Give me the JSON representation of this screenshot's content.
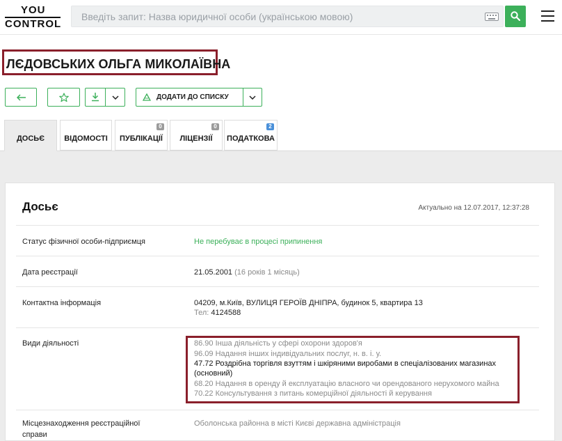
{
  "header": {
    "logo_top": "YOU",
    "logo_bottom": "CONTROL",
    "search_placeholder": "Введіть запит: Назва юридичної особи (українською мовою)"
  },
  "person": {
    "name": "ЛЄДОВСЬКИХ ОЛЬГА МИКОЛАЇВНА"
  },
  "actions": {
    "add_to_list": "ДОДАТИ ДО СПИСКУ"
  },
  "tabs": [
    {
      "label": "ДОСЬЄ",
      "active": true
    },
    {
      "label": "ВІДОМОСТІ"
    },
    {
      "label": "ПУБЛІКАЦІЇ",
      "badge": "0"
    },
    {
      "label": "ЛІЦЕНЗІЇ",
      "badge": "0"
    },
    {
      "label": "ПОДАТКОВА",
      "badge": "2"
    }
  ],
  "dossier": {
    "title": "Досьє",
    "updated": "Актуально на 12.07.2017, 12:37:28",
    "status_label": "Статус фізичної особи-підприємця",
    "status_value": "Не перебуває в процесі припинення",
    "reg_label": "Дата реєстрації",
    "reg_date": "21.05.2001",
    "reg_duration": "(16 років 1 місяць)",
    "contact_label": "Контактна інформація",
    "address": "04209, м.Київ, ВУЛИЦЯ ГЕРОЇВ ДНІПРА, будинок 5, квартира 13",
    "phone_label": "Тел:",
    "phone": "4124588",
    "activities_label": "Види діяльності",
    "activities": [
      "86.90 Інша діяльність у сфері охорони здоров'я",
      "96.09 Надання інших індивідуальних послуг, н. в. і. у.",
      "47.72 Роздрібна торгівля взуттям і шкіряними виробами в спеціалізованих магазинах",
      "(основний)",
      "68.20 Надання в оренду й експлуатацію власного чи орендованого нерухомого майна",
      "70.22 Консультування з питань комерційної діяльності й керування"
    ],
    "location_label_1": "Місцезнаходження реєстраційної",
    "location_label_2": "справи",
    "location_value": "Оболонська районна в місті Києві державна адміністрація"
  }
}
